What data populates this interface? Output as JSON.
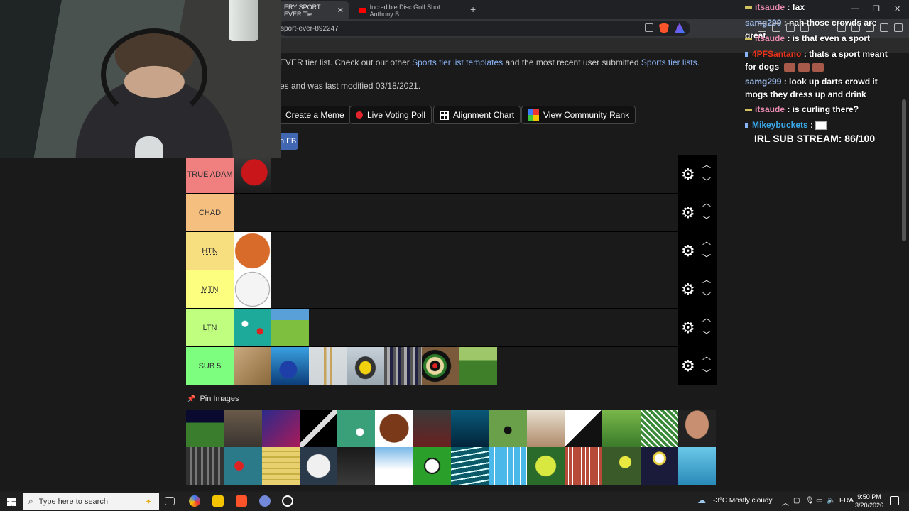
{
  "browser": {
    "tabs": [
      {
        "label": "ERY SPORT EVER Tie",
        "active": true
      },
      {
        "label": "Incredible Disc Golf Shot: Anthony B",
        "active": false
      }
    ],
    "url_fragment": "sport-ever-892247",
    "new_tab": "+",
    "window_controls": {
      "minimize": "—",
      "maximize": "❐",
      "close": "✕"
    }
  },
  "page": {
    "intro_before": "EVER tier list. Check out our other ",
    "intro_link1": "Sports tier list templates",
    "intro_middle": " and the most recent user submitted ",
    "intro_link2": "Sports tier lists",
    "intro_after": ".",
    "modified": "es and was last modified 03/18/2021.",
    "buttons": {
      "meme": "Create a Meme",
      "poll": "Live Voting Poll",
      "alignment": "Alignment Chart",
      "community": "View Community Rank"
    },
    "fb_share": "n FB",
    "tiers": [
      {
        "label": "TRUE ADAM",
        "color": "#f07f80",
        "items": [
          "boxing-glove"
        ]
      },
      {
        "label": "CHAD",
        "color": "#f5bf80",
        "items": []
      },
      {
        "label": "HTN",
        "color": "#f7de7f",
        "items": [
          "basketball"
        ]
      },
      {
        "label": "MTN",
        "color": "#fdfe80",
        "items": [
          "baseball"
        ]
      },
      {
        "label": "LTN",
        "color": "#bffe7e",
        "items": [
          "billiards",
          "croquet"
        ]
      },
      {
        "label": "SUB 5",
        "color": "#7efe7f",
        "items": [
          "finger-board",
          "bowling",
          "cricket",
          "curling",
          "cycling",
          "darts",
          "disc-golf"
        ]
      }
    ],
    "pin_label": "Pin Images",
    "pool_count": 28
  },
  "chat": {
    "messages": [
      {
        "user": "itsaude",
        "text": " : fax",
        "color": "pink",
        "badge": "dash"
      },
      {
        "user": "samg299",
        "text": " : nah those crowds are great",
        "color": "blue",
        "badge": "none"
      },
      {
        "user": "itsaude",
        "text": " : is that even a sport",
        "color": "pink",
        "badge": "dash"
      },
      {
        "user": "4PFSantano",
        "text": " : thats a sport meant for dogs",
        "color": "red",
        "badge": "sub"
      },
      {
        "user": "samg299",
        "text": " : look up darts crowd it mogs they dress up and drink",
        "color": "blue",
        "badge": "none"
      },
      {
        "user": "itsaude",
        "text": " : is curling there?",
        "color": "pink",
        "badge": "dash"
      },
      {
        "user": "Mikeybuckets",
        "text": " : ",
        "color": "cyan",
        "badge": "sub"
      }
    ],
    "goal": "IRL SUB STREAM: 86/100"
  },
  "taskbar": {
    "search_placeholder": "Type here to search",
    "weather": "-3°C  Mostly cloudy",
    "lang": "FRA",
    "time": "9:50 PM",
    "date": "3/20/2026"
  }
}
